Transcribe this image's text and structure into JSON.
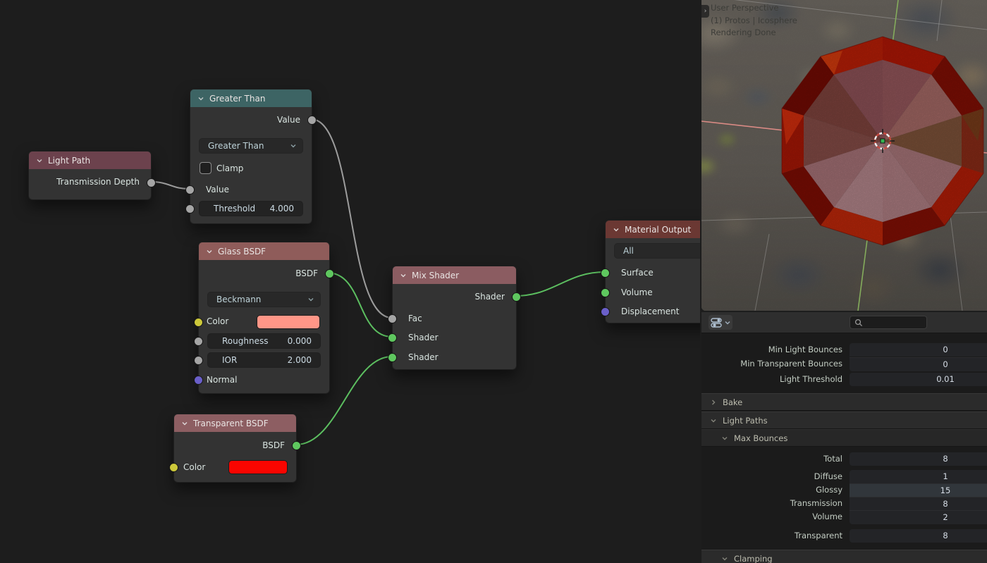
{
  "nodes": {
    "greater_than": {
      "title": "Greater Than",
      "output_label": "Value",
      "operation": "Greater Than",
      "clamp_label": "Clamp",
      "input_label": "Value",
      "threshold_label": "Threshold",
      "threshold_value": "4.000"
    },
    "light_path": {
      "title": "Light Path",
      "output_label": "Transmission Depth"
    },
    "glass": {
      "title": "Glass BSDF",
      "output_label": "BSDF",
      "distribution": "Beckmann",
      "color_label": "Color",
      "color_hex": "#ff9687",
      "roughness_label": "Roughness",
      "roughness_value": "0.000",
      "ior_label": "IOR",
      "ior_value": "2.000",
      "normal_label": "Normal"
    },
    "transparent": {
      "title": "Transparent BSDF",
      "output_label": "BSDF",
      "color_label": "Color",
      "color_hex": "#f90500"
    },
    "mix": {
      "title": "Mix Shader",
      "output_label": "Shader",
      "fac_label": "Fac",
      "shader1_label": "Shader",
      "shader2_label": "Shader"
    },
    "material_output": {
      "title": "Material Output",
      "target_value": "All",
      "surface_label": "Surface",
      "volume_label": "Volume",
      "displacement_label": "Displacement"
    }
  },
  "viewport": {
    "overlay_line1": "User Perspective",
    "overlay_line2": "(1) Protos | Icosphere",
    "overlay_line3": "Rendering Done",
    "sidebar_toggle": "›"
  },
  "properties": {
    "top_rows": [
      {
        "label": "Min Light Bounces",
        "value": "0"
      },
      {
        "label": "Min Transparent Bounces",
        "value": "0"
      },
      {
        "label": "Light Threshold",
        "value": "0.01"
      }
    ],
    "bake_label": "Bake",
    "light_paths_label": "Light Paths",
    "max_bounces_label": "Max Bounces",
    "clamping_label": "Clamping",
    "bounce_rows": [
      {
        "label": "Total",
        "value": "8"
      },
      {
        "label": "Diffuse",
        "value": "1"
      },
      {
        "label": "Glossy",
        "value": "15"
      },
      {
        "label": "Transmission",
        "value": "8"
      },
      {
        "label": "Volume",
        "value": "2"
      },
      {
        "label": "Transparent",
        "value": "8"
      }
    ]
  },
  "colors": {
    "header_math": "#3d6464",
    "header_input": "#6c424d",
    "header_shader": "#8f5c5a",
    "header_output": "#6b3833",
    "socket_shader": "#5fc75f",
    "socket_value": "#a5a5a5",
    "socket_color": "#ccc83a",
    "socket_vector": "#6a5fc9",
    "wire_gray": "#9d9d9d",
    "wire_green": "#5cbf60",
    "glass_color_swatch": "#ff9687",
    "transparent_color_swatch": "#f90500"
  }
}
